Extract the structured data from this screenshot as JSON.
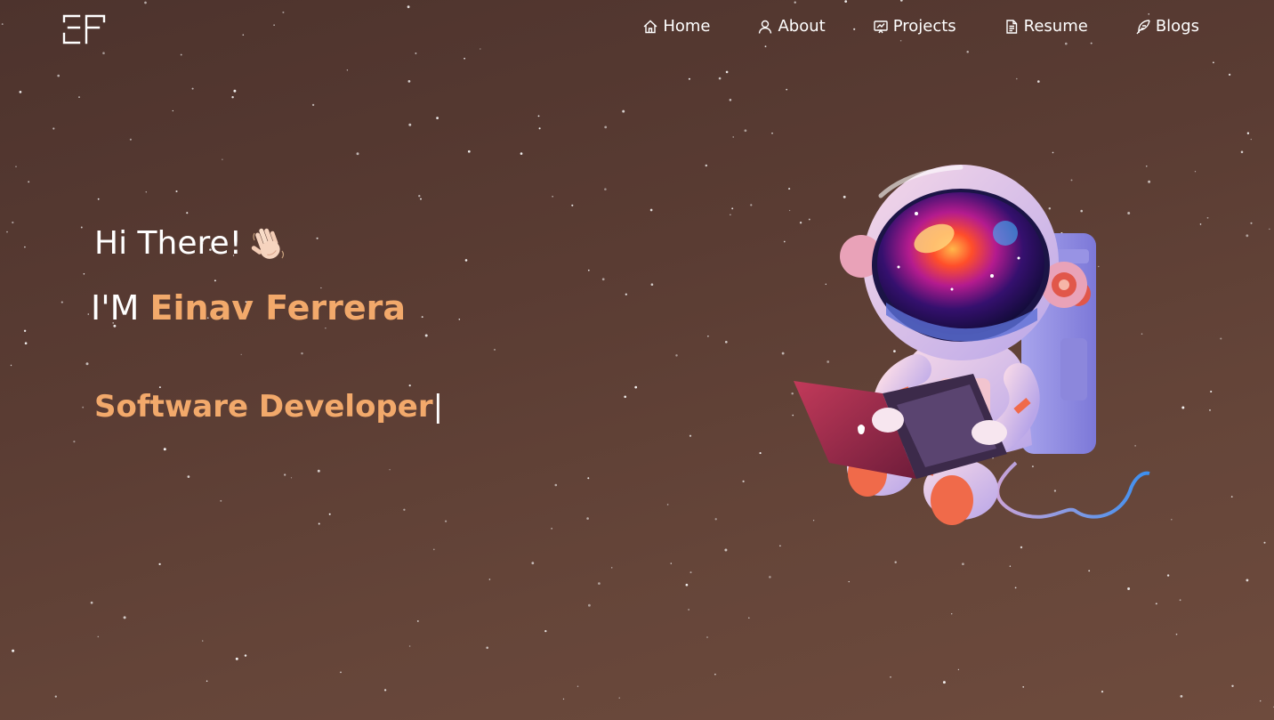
{
  "brand": {
    "logo_text": "EF"
  },
  "nav": {
    "items": [
      {
        "label": "Home",
        "icon": "home-icon"
      },
      {
        "label": "About",
        "icon": "user-icon"
      },
      {
        "label": "Projects",
        "icon": "projects-icon"
      },
      {
        "label": "Resume",
        "icon": "document-icon"
      },
      {
        "label": "Blogs",
        "icon": "feather-icon"
      }
    ]
  },
  "hero": {
    "greeting": "Hi There!",
    "wave_emoji": "👋",
    "intro_prefix": "I'M",
    "name": "Einav Ferrera",
    "typewriter_text": "Software Developer",
    "cursor": "|",
    "illustration": "astronaut-with-laptop"
  },
  "colors": {
    "background_top": "#4d332d",
    "background_bottom": "#6e4b3d",
    "accent": "#f2a96b",
    "text": "#ffffff"
  }
}
